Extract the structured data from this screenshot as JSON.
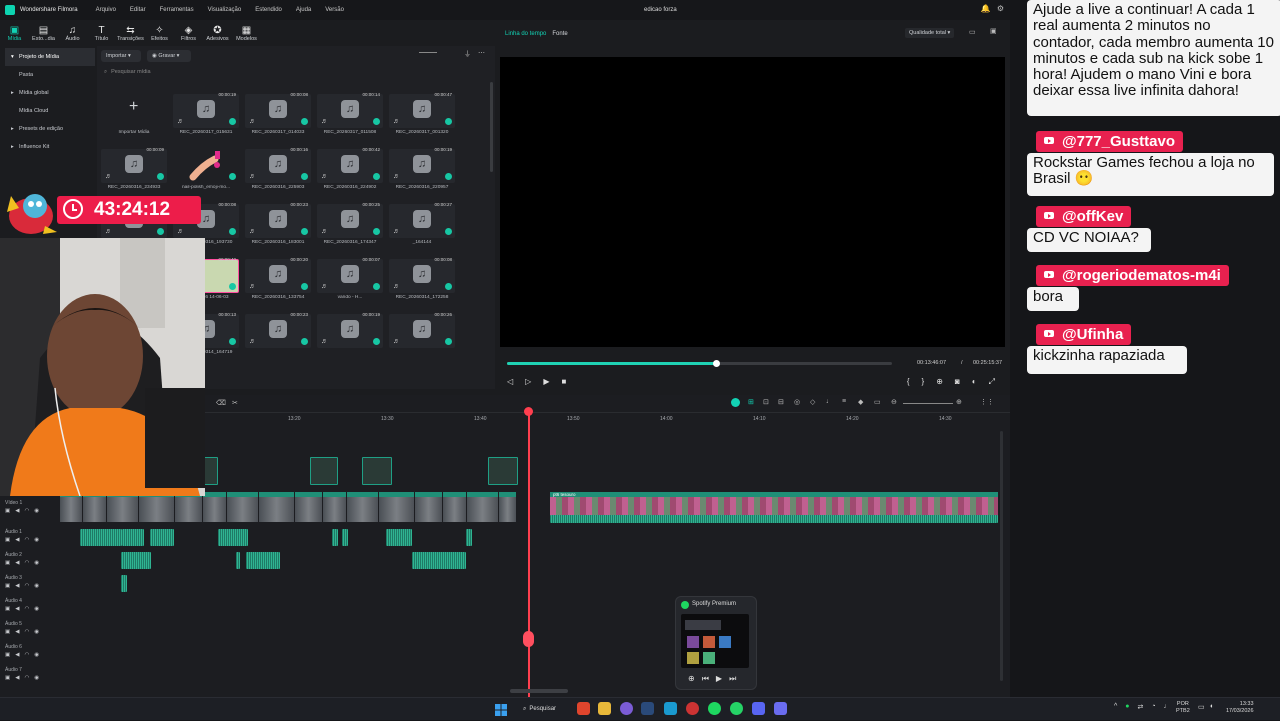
{
  "app": {
    "name": "Wondershare Filmora",
    "menu": [
      "Arquivo",
      "Editar",
      "Ferramentas",
      "Visualização",
      "Estendido",
      "Ajuda",
      "Versão"
    ],
    "document": "edicao forza"
  },
  "toolbar": [
    {
      "label": "Mídia",
      "icon": "media-icon",
      "glyph": "▣",
      "active": true
    },
    {
      "label": "Esto...dia",
      "icon": "stock-media-icon",
      "glyph": "▤",
      "active": false
    },
    {
      "label": "Áudio",
      "icon": "audio-icon",
      "glyph": "♫",
      "active": false
    },
    {
      "label": "Título",
      "icon": "title-icon",
      "glyph": "T",
      "active": false
    },
    {
      "label": "Transições",
      "icon": "transitions-icon",
      "glyph": "⇆",
      "active": false
    },
    {
      "label": "Efeitos",
      "icon": "effects-icon",
      "glyph": "✧",
      "active": false
    },
    {
      "label": "Filtros",
      "icon": "filters-icon",
      "glyph": "◈",
      "active": false
    },
    {
      "label": "Adesivos",
      "icon": "stickers-icon",
      "glyph": "✪",
      "active": false
    },
    {
      "label": "Modelos",
      "icon": "templates-icon",
      "glyph": "▦",
      "active": false
    }
  ],
  "sidebar": {
    "items": [
      {
        "label": "Projeto de Mídia",
        "active": true,
        "arrow": "▾"
      },
      {
        "label": "Pasta",
        "active": false,
        "arrow": ""
      },
      {
        "label": "Mídia global",
        "active": false,
        "arrow": "▸"
      },
      {
        "label": "Mídia Cloud",
        "active": false,
        "arrow": ""
      },
      {
        "label": "Presets de edição",
        "active": false,
        "arrow": "▸"
      },
      {
        "label": "Influence Kit",
        "active": false,
        "arrow": "▸"
      }
    ]
  },
  "media": {
    "import_label": "Importar",
    "record_label": "Gravar",
    "search_placeholder": "Pesquisar mídia",
    "import_tile_label": "Importar Mídia",
    "tiles": [
      {
        "label": "REC_20260317_015631",
        "dur": "00:00:19"
      },
      {
        "label": "REC_20260317_014033",
        "dur": "00:00:08"
      },
      {
        "label": "REC_20260317_011508",
        "dur": "00:00:14"
      },
      {
        "label": "REC_20260317_001320",
        "dur": "00:00:47"
      },
      {
        "label": "REC_20260316_234933",
        "dur": "00:00:09"
      },
      {
        "label": "nail-polish_emoji-mo...",
        "dur": ""
      },
      {
        "label": "REC_20260316_225903",
        "dur": "00:00:16"
      },
      {
        "label": "REC_20260316_224902",
        "dur": "00:00:42"
      },
      {
        "label": "REC_20260316_220957",
        "dur": "00:00:19"
      },
      {
        "label": "0316_195444",
        "dur": "00:00:09"
      },
      {
        "label": "REC_20260316_193730",
        "dur": "00:00:08"
      },
      {
        "label": "REC_20260316_183001",
        "dur": "00:00:23"
      },
      {
        "label": "REC_20260316_174347",
        "dur": "00:00:25"
      },
      {
        "label": "_164144",
        "dur": "00:00:27"
      },
      {
        "label": "REC_20260316_152721",
        "dur": "00:00:31"
      },
      {
        "label": "2026-03-16 14-06-03",
        "dur": "00:00:40"
      },
      {
        "label": "REC_20260316_133754",
        "dur": "00:00:20"
      },
      {
        "label": "vando - H...",
        "dur": "00:00:07"
      },
      {
        "label": "REC_20260314_172258",
        "dur": "00:00:08"
      },
      {
        "label": "REC_20260316_165409",
        "dur": "00:00:11"
      },
      {
        "label": "REC_20260314_164719",
        "dur": "00:00:13"
      },
      {
        "label": "",
        "dur": "00:00:23"
      },
      {
        "label": "",
        "dur": "00:00:19"
      },
      {
        "label": "",
        "dur": "00:00:26"
      },
      {
        "label": "",
        "dur": ""
      }
    ]
  },
  "preview": {
    "tab_timeline": "Linha do tempo",
    "tab_source": "Fonte",
    "quality": "Qualidade total",
    "progress": 0.545,
    "current_time": "00:13:46:07",
    "separator": "/",
    "total_time": "00:25:15:37"
  },
  "timeline": {
    "ruler": [
      "13:20",
      "13:30",
      "13:40",
      "13:50",
      "14:00",
      "14:10",
      "14:20",
      "14:30"
    ],
    "tracks": [
      "Vídeo 1",
      "Áudio 1",
      "Áudio 2",
      "Áudio 3",
      "Áudio 4",
      "Áudio 5",
      "Áudio 6",
      "Áudio 7"
    ],
    "clip_labels": [
      "pt6",
      "pt6",
      "pt6",
      "pt6 tesouro"
    ],
    "audio_labels": [
      "REC_2026...1506",
      "REC_2...",
      "REC_20...",
      "REC_202...21551"
    ]
  },
  "overlay": {
    "timer": "43:24:12"
  },
  "spotify": {
    "title": "Spotify Premium"
  },
  "chat": {
    "top_message": "Ajude a live a continuar! A cada 1 real aumenta 2 minutos no contador, cada membro aumenta 10 minutos e cada sub na kick sobe 1 hora! Ajudem o mano Vini e bora deixar essa live infinita dahora!",
    "messages": [
      {
        "user": "@777_Gusttavo",
        "text": "Rockstar Games fechou a loja no Brasil 😶"
      },
      {
        "user": "@offKev",
        "text": "CD VC NOIAA?"
      },
      {
        "user": "@rogeriodematos-m4i",
        "text": "bora"
      },
      {
        "user": "@Ufinha",
        "text": "kickzinha rapaziada"
      }
    ]
  },
  "taskbar": {
    "search_label": "Pesquisar",
    "lang_top": "POR",
    "lang_bottom": "PTB2",
    "time": "13:33",
    "date": "17/03/2026"
  },
  "colors": {
    "accent": "#12d2b4",
    "playhead": "#ff3f4f",
    "chat_name_bg": "#e8214f",
    "timer_bg": "#ed1d4a"
  }
}
